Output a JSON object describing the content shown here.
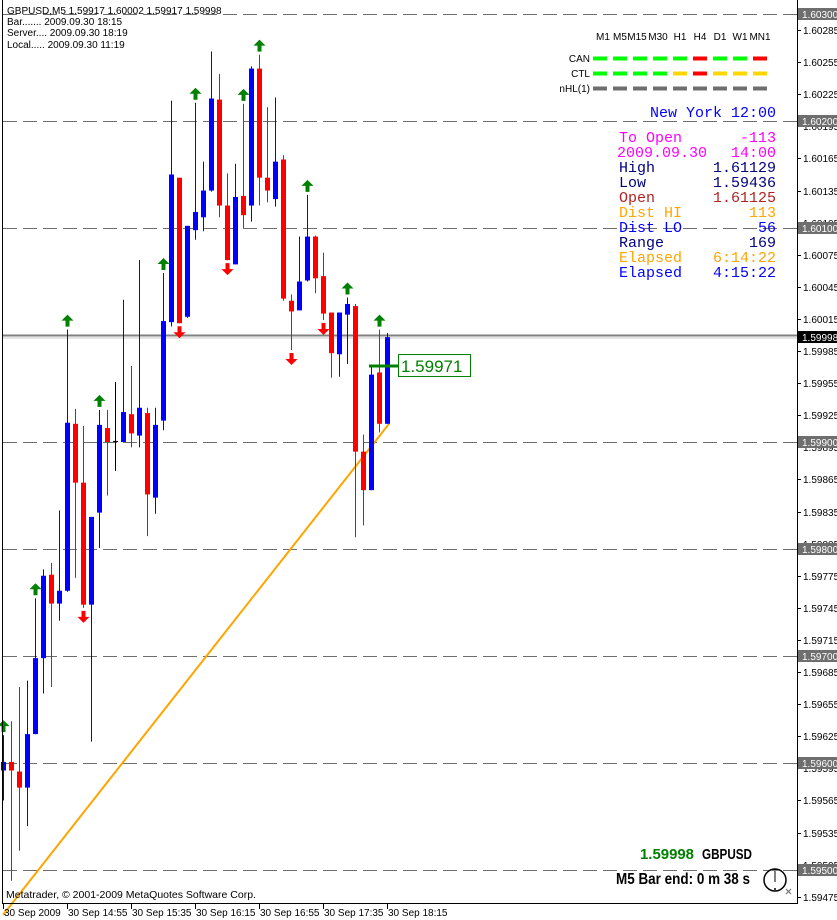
{
  "header": {
    "symbol_line": "GBPUSD,M5  1.59917 1.60002 1.59917 1.59998",
    "bar_line": "Bar....... 2009.09.30 18:15",
    "server_line": "Server.... 2009.09.30 18:19",
    "local_line": "Local..... 2009.09.30 11:19"
  },
  "indicator_grid": {
    "timeframes": [
      "M1",
      "M5",
      "M15",
      "M30",
      "H1",
      "H4",
      "D1",
      "W1",
      "MN1"
    ],
    "rows": [
      {
        "label": "CAN",
        "colors": [
          "#00ff00",
          "#00ff00",
          "#00ff00",
          "#00ff00",
          "#00ff00",
          "#ff0000",
          "#00ff00",
          "#00ff00",
          "#ff0000"
        ]
      },
      {
        "label": "CTL",
        "colors": [
          "#00ff00",
          "#00ff00",
          "#00ff00",
          "#00ff00",
          "#ffd700",
          "#ff0000",
          "#ffd700",
          "#ffd700",
          "#ffd700"
        ]
      },
      {
        "label": "nHL(1)",
        "colors": [
          "#6e6e6e",
          "#6e6e6e",
          "#6e6e6e",
          "#6e6e6e",
          "#6e6e6e",
          "#6e6e6e",
          "#6e6e6e",
          "#6e6e6e",
          "#6e6e6e"
        ]
      }
    ]
  },
  "info_panel": {
    "title": "New York 12:00",
    "title_color": "#0000ff",
    "rows": [
      {
        "label": "To Open",
        "value": "-113",
        "color": "#ff00ff"
      },
      {
        "label": "2009.09.30",
        "value": "14:00",
        "color": "#ff00ff"
      },
      {
        "label": "High",
        "value": "1.61129",
        "color": "#000080"
      },
      {
        "label": "Low",
        "value": "1.59436",
        "color": "#000080"
      },
      {
        "label": "Open",
        "value": "1.61125",
        "color": "#b22222"
      },
      {
        "label": "Dist HI",
        "value": "113",
        "color": "#ffa500"
      },
      {
        "label": "Dist LO",
        "value": "56",
        "color": "#0000ff"
      },
      {
        "label": "Range",
        "value": "169",
        "color": "#000080"
      },
      {
        "label": "Elapsed",
        "value": "6:14:22",
        "color": "#ffa500"
      },
      {
        "label": "Elapsed",
        "value": "4:15:22",
        "color": "#0000ff"
      }
    ]
  },
  "footer": {
    "price": "1.59998",
    "symbol": "GBPUSD",
    "bar_end": "M5 Bar end: 0 m 38 s",
    "copyright": "Metatrader, © 2001-2009 MetaQuotes Software Corp."
  },
  "price_label": "1.59971",
  "colors": {
    "bull": "#0000ff",
    "bear": "#ff0000",
    "doji": "#000000",
    "up_arrow": "#008000",
    "down_arrow": "#ff0000",
    "trendline": "#ffa500",
    "grid": "#6e6e6e"
  },
  "chart_data": {
    "type": "candlestick",
    "title": "GBPUSD,M5",
    "ylim": [
      1.5946,
      1.60313
    ],
    "y_ticks": [
      "1.60285",
      "1.60255",
      "1.60225",
      "1.60195",
      "1.60165",
      "1.60135",
      "1.60105",
      "1.60075",
      "1.60045",
      "1.60015",
      "1.59985",
      "1.59955",
      "1.59925",
      "1.59895",
      "1.59865",
      "1.59835",
      "1.59805",
      "1.59775",
      "1.59745",
      "1.59715",
      "1.59685",
      "1.59655",
      "1.59625",
      "1.59595",
      "1.59565",
      "1.59535",
      "1.59505",
      "1.59475"
    ],
    "round_levels": [
      "1.60300",
      "1.60200",
      "1.60100",
      "1.59900",
      "1.59800",
      "1.59700",
      "1.59600",
      "1.59500"
    ],
    "bid": "1.59998",
    "x_labels": [
      {
        "bar": 0,
        "label": "30 Sep 2009"
      },
      {
        "bar": 8,
        "label": "30 Sep 14:55"
      },
      {
        "bar": 16,
        "label": "30 Sep 15:35"
      },
      {
        "bar": 24,
        "label": "30 Sep 16:15"
      },
      {
        "bar": 32,
        "label": "30 Sep 16:55"
      },
      {
        "bar": 40,
        "label": "30 Sep 17:35"
      },
      {
        "bar": 48,
        "label": "30 Sep 18:15"
      }
    ],
    "candles": [
      [
        1.59593,
        1.59626,
        1.59565,
        1.59601
      ],
      [
        1.59601,
        1.59639,
        1.5949,
        1.59593
      ],
      [
        1.59592,
        1.59671,
        1.59518,
        1.59577
      ],
      [
        1.59577,
        1.59677,
        1.59541,
        1.59627
      ],
      [
        1.59627,
        1.59754,
        1.59627,
        1.59698
      ],
      [
        1.59698,
        1.59781,
        1.59665,
        1.59775
      ],
      [
        1.59776,
        1.59787,
        1.59671,
        1.59749
      ],
      [
        1.59749,
        1.59836,
        1.59733,
        1.59761
      ],
      [
        1.59761,
        1.60005,
        1.5976,
        1.59918
      ],
      [
        1.59917,
        1.59931,
        1.59773,
        1.59862
      ],
      [
        1.59862,
        1.59915,
        1.59745,
        1.59748
      ],
      [
        1.59748,
        1.5983,
        1.5962,
        1.5983
      ],
      [
        1.59834,
        1.5993,
        1.59801,
        1.59916
      ],
      [
        1.59913,
        1.5993,
        1.5985,
        1.599
      ],
      [
        1.59901,
        1.59956,
        1.59873,
        1.59901
      ],
      [
        1.599,
        1.60033,
        1.599,
        1.59928
      ],
      [
        1.59926,
        1.59971,
        1.59895,
        1.59908
      ],
      [
        1.59906,
        1.6007,
        1.59895,
        1.59932
      ],
      [
        1.59927,
        1.59932,
        1.59812,
        1.59851
      ],
      [
        1.59848,
        1.59932,
        1.59833,
        1.59916
      ],
      [
        1.5992,
        1.60058,
        1.59911,
        1.60013
      ],
      [
        1.60012,
        1.60219,
        1.60008,
        1.6015
      ],
      [
        1.60147,
        1.60147,
        1.60011,
        1.60011
      ],
      [
        1.60017,
        1.60102,
        1.60016,
        1.60102
      ],
      [
        1.60098,
        1.60217,
        1.60089,
        1.60115
      ],
      [
        1.6011,
        1.60162,
        1.60097,
        1.60135
      ],
      [
        1.60135,
        1.60265,
        1.60134,
        1.60221
      ],
      [
        1.6022,
        1.60244,
        1.6011,
        1.60121
      ],
      [
        1.60121,
        1.60151,
        1.6007,
        1.6007
      ],
      [
        1.60066,
        1.6016,
        1.60066,
        1.60129
      ],
      [
        1.6013,
        1.60216,
        1.601,
        1.60112
      ],
      [
        1.60121,
        1.60251,
        1.60106,
        1.60249
      ],
      [
        1.60249,
        1.60262,
        1.60121,
        1.60147
      ],
      [
        1.60147,
        1.60213,
        1.60124,
        1.60135
      ],
      [
        1.60127,
        1.60222,
        1.6012,
        1.60162
      ],
      [
        1.60164,
        1.60168,
        1.60032,
        1.60034
      ],
      [
        1.60032,
        1.60038,
        1.59986,
        1.60022
      ],
      [
        1.60023,
        1.60092,
        1.60023,
        1.6005
      ],
      [
        1.60051,
        1.60131,
        1.6005,
        1.60092
      ],
      [
        1.60092,
        1.60093,
        1.60039,
        1.60053
      ],
      [
        1.60055,
        1.60077,
        1.60014,
        1.6002
      ],
      [
        1.60021,
        1.60021,
        1.5996,
        1.59983
      ],
      [
        1.59982,
        1.60021,
        1.59961,
        1.60021
      ],
      [
        1.60019,
        1.60035,
        1.59973,
        1.60029
      ],
      [
        1.60027,
        1.60029,
        1.59811,
        1.59891
      ],
      [
        1.59891,
        1.59907,
        1.59822,
        1.59855
      ],
      [
        1.59855,
        1.5997,
        1.59855,
        1.59963
      ],
      [
        1.59965,
        1.60005,
        1.59909,
        1.59917
      ],
      [
        1.59917,
        1.60002,
        1.59917,
        1.59998
      ]
    ],
    "candle_fields": [
      "open",
      "high",
      "low",
      "close"
    ],
    "up_arrows": [
      0,
      4,
      8,
      12,
      20,
      24,
      30,
      32,
      38,
      43,
      47
    ],
    "down_arrows": [
      10,
      22,
      28,
      36,
      40
    ],
    "trendline": {
      "from": {
        "bar": 0,
        "price": 1.59458
      },
      "to": {
        "bar": 48,
        "price": 1.59917
      }
    },
    "price_marker": {
      "bar": 46,
      "price": 1.59971
    }
  }
}
